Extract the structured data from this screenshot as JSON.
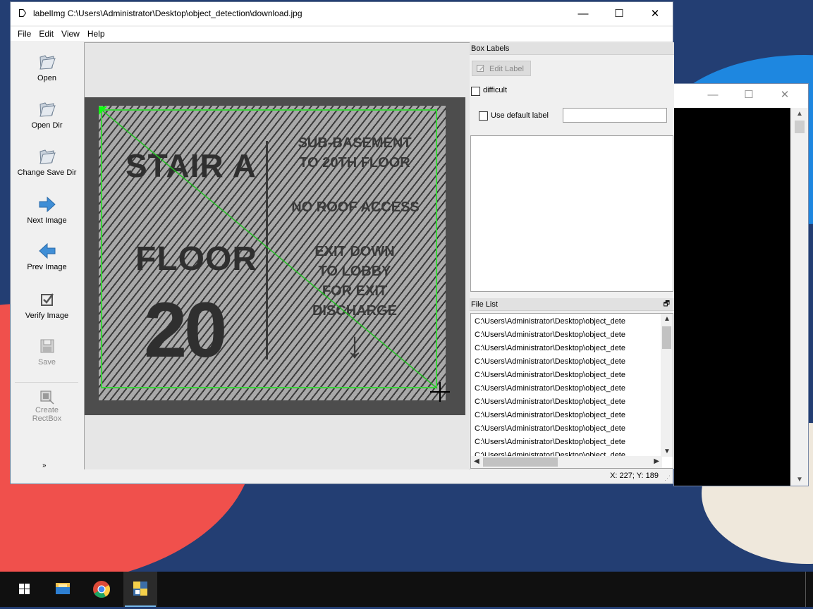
{
  "window": {
    "title": "labelImg C:\\Users\\Administrator\\Desktop\\object_detection\\download.jpg",
    "minimize": "—",
    "maximize": "☐",
    "close": "✕"
  },
  "menu": [
    "File",
    "Edit",
    "View",
    "Help"
  ],
  "toolbar": {
    "open": "Open",
    "open_dir": "Open Dir",
    "change_save_dir": "Change Save Dir",
    "next_image": "Next Image",
    "prev_image": "Prev Image",
    "verify_image": "Verify Image",
    "save": "Save",
    "create_rectbox_1": "Create",
    "create_rectbox_2": "RectBox",
    "more": "»"
  },
  "image_text": {
    "stair": "STAIR A",
    "floor": "FLOOR",
    "number": "20",
    "line1": "SUB-BASEMENT",
    "line2": "TO 20TH FLOOR",
    "line3": "NO ROOF ACCESS",
    "line4": "EXIT DOWN",
    "line5": "TO LOBBY",
    "line6": "FOR EXIT",
    "line7": "DISCHARGE",
    "arrow": "↓"
  },
  "box_labels": {
    "title": "Box Labels",
    "edit_label": "Edit Label",
    "difficult": "difficult",
    "use_default_label": "Use default label",
    "default_label_value": ""
  },
  "file_list": {
    "title": "File List",
    "float_icon": "🗗",
    "rows": [
      "C:\\Users\\Administrator\\Desktop\\object_dete",
      "C:\\Users\\Administrator\\Desktop\\object_dete",
      "C:\\Users\\Administrator\\Desktop\\object_dete",
      "C:\\Users\\Administrator\\Desktop\\object_dete",
      "C:\\Users\\Administrator\\Desktop\\object_dete",
      "C:\\Users\\Administrator\\Desktop\\object_dete",
      "C:\\Users\\Administrator\\Desktop\\object_dete",
      "C:\\Users\\Administrator\\Desktop\\object_dete",
      "C:\\Users\\Administrator\\Desktop\\object_dete",
      "C:\\Users\\Administrator\\Desktop\\object_dete",
      "C:\\Users\\Administrator\\Desktop\\object_dete"
    ]
  },
  "status": {
    "coords": "X: 227; Y: 189"
  },
  "colors": {
    "bbox": "#3bd23b",
    "wallpaper": "#233e73",
    "accent": "#76b9ed"
  },
  "taskbar": {
    "icons": [
      "windows-start-icon",
      "file-explorer-icon",
      "chrome-icon",
      "python-icon"
    ]
  }
}
